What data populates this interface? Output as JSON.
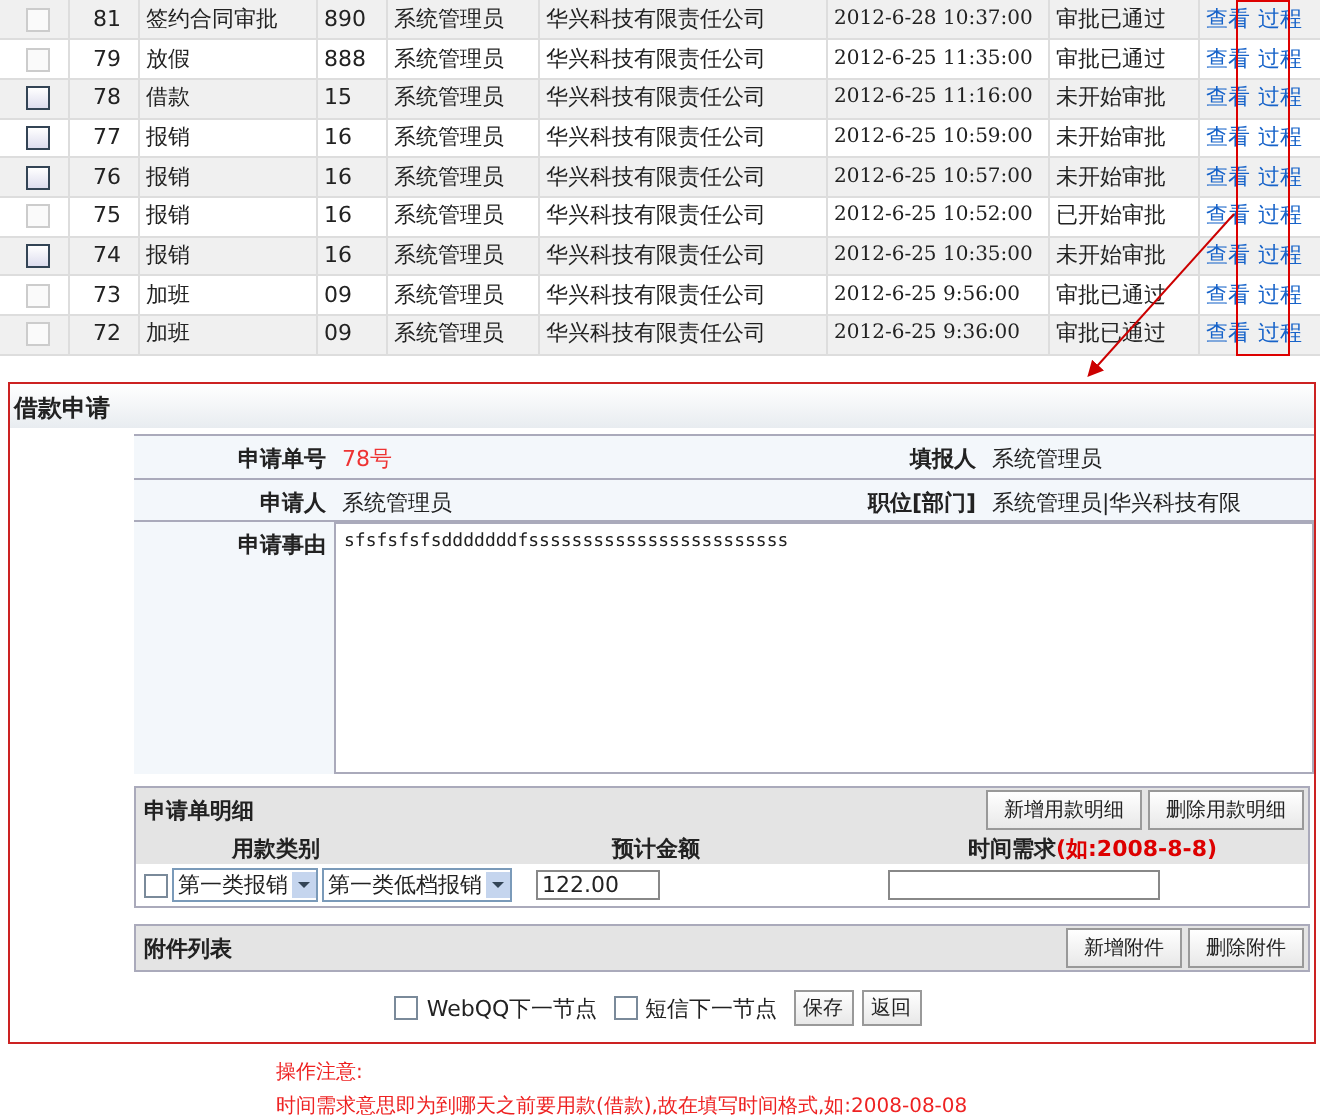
{
  "records": [
    {
      "disabled": true,
      "id": "81",
      "type": "签约合同审批",
      "number": "890",
      "user": "系统管理员",
      "company": "华兴科技有限责任公司",
      "time": "2012-6-28 10:37:00",
      "status": "审批已通过",
      "actions": [
        "查看",
        "过程"
      ]
    },
    {
      "disabled": true,
      "id": "79",
      "type": "放假",
      "number": "888",
      "user": "系统管理员",
      "company": "华兴科技有限责任公司",
      "time": "2012-6-25 11:35:00",
      "status": "审批已通过",
      "actions": [
        "查看",
        "过程"
      ]
    },
    {
      "disabled": false,
      "id": "78",
      "type": "借款",
      "number": "15",
      "user": "系统管理员",
      "company": "华兴科技有限责任公司",
      "time": "2012-6-25 11:16:00",
      "status": "未开始审批",
      "actions": [
        "查看",
        "过程"
      ]
    },
    {
      "disabled": false,
      "id": "77",
      "type": "报销",
      "number": "16",
      "user": "系统管理员",
      "company": "华兴科技有限责任公司",
      "time": "2012-6-25 10:59:00",
      "status": "未开始审批",
      "actions": [
        "查看",
        "过程"
      ]
    },
    {
      "disabled": false,
      "id": "76",
      "type": "报销",
      "number": "16",
      "user": "系统管理员",
      "company": "华兴科技有限责任公司",
      "time": "2012-6-25 10:57:00",
      "status": "未开始审批",
      "actions": [
        "查看",
        "过程"
      ]
    },
    {
      "disabled": true,
      "id": "75",
      "type": "报销",
      "number": "16",
      "user": "系统管理员",
      "company": "华兴科技有限责任公司",
      "time": "2012-6-25 10:52:00",
      "status": "已开始审批",
      "actions": [
        "查看",
        "过程"
      ]
    },
    {
      "disabled": false,
      "id": "74",
      "type": "报销",
      "number": "16",
      "user": "系统管理员",
      "company": "华兴科技有限责任公司",
      "time": "2012-6-25 10:35:00",
      "status": "未开始审批",
      "actions": [
        "查看",
        "过程"
      ]
    },
    {
      "disabled": true,
      "id": "73",
      "type": "加班",
      "number": "09",
      "user": "系统管理员",
      "company": "华兴科技有限责任公司",
      "time": "2012-6-25 9:56:00",
      "status": "审批已通过",
      "actions": [
        "查看",
        "过程"
      ]
    },
    {
      "disabled": true,
      "id": "72",
      "type": "加班",
      "number": "09",
      "user": "系统管理员",
      "company": "华兴科技有限责任公司",
      "time": "2012-6-25 9:36:00",
      "status": "审批已通过",
      "actions": [
        "查看",
        "过程"
      ]
    }
  ],
  "form": {
    "title": "借款申请",
    "order_no": {
      "label": "申请单号",
      "value": "78号"
    },
    "reporter": {
      "label": "填报人",
      "value": "系统管理员"
    },
    "applicant": {
      "label": "申请人",
      "value": "系统管理员"
    },
    "position": {
      "label": "职位[部门]",
      "value": "系统管理员|华兴科技有限"
    },
    "reason": {
      "label": "申请事由",
      "value": "sfsfsfsfsdddddddfssssssssssssssssssssssss"
    },
    "details": {
      "title": "申请单明细",
      "buttons": [
        "新增用款明细",
        "删除用款明细"
      ],
      "columns": {
        "category": "用款类别",
        "amount": "预计金额",
        "time": "时间需求",
        "time_hint": "(如:2008-8-8)"
      },
      "rows": [
        {
          "checked": false,
          "category": "第一类报销",
          "subcategory": "第一类低档报销",
          "amount": "122.00"
        }
      ]
    },
    "attachments": {
      "title": "附件列表",
      "buttons": [
        "新增附件",
        "删除附件"
      ]
    },
    "footer": {
      "options": [
        {
          "label": "WebQQ下一节点",
          "checked": false
        },
        {
          "label": "短信下一节点",
          "checked": false
        }
      ],
      "buttons": [
        "保存",
        "返回"
      ]
    }
  },
  "notes": [
    "操作注意:",
    "时间需求意思即为到哪天之前要用款(借款),故在填写时间格式,如:2008-08-08"
  ]
}
